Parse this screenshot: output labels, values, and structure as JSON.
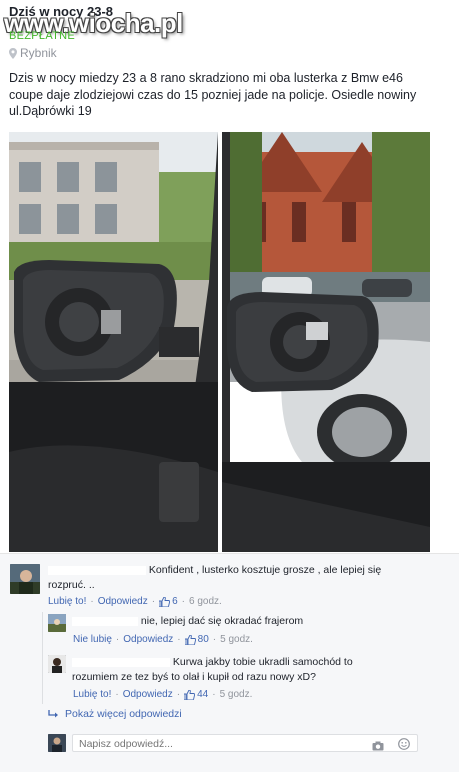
{
  "post": {
    "title": "Dziś w nocy 23-8",
    "watermark": "www.wiocha.pl",
    "price": "BEZPŁATNE",
    "location": "Rybnik",
    "body": "Dzis w nocy miedzy 23 a 8 rano skradziono mi oba lusterka z Bmw e46 coupe daje zlodziejowi czas do 15 pozniej jade na policje. Osiedle nowiny ul.Dąbrówki 19"
  },
  "comments": [
    {
      "text": "Konfident , lusterko kosztuje grosze , ale lepiej się rozpruć. ..",
      "like_label": "Lubię to!",
      "reply_label": "Odpowiedz",
      "likes": "6",
      "time": "6 godz."
    }
  ],
  "replies": [
    {
      "text": "nie, lepiej dać się okradać frajerom",
      "like_label": "Nie lubię",
      "reply_label": "Odpowiedz",
      "likes": "80",
      "time": "5 godz."
    },
    {
      "text": "Kurwa jakby tobie ukradli samochód to rozumiem ze tez byś to olał i kupił od razu nowy xD?",
      "like_label": "Lubię to!",
      "reply_label": "Odpowiedz",
      "likes": "44",
      "time": "5 godz."
    }
  ],
  "more_replies": "Pokaż więcej odpowiedzi",
  "reply_box": {
    "placeholder": "Napisz odpowiedź..."
  },
  "colors": {
    "link": "#4267b2",
    "muted": "#90949c",
    "green": "#42b72a",
    "text": "#1d2129"
  },
  "icons": [
    "pin-icon",
    "thumb-up-icon",
    "reply-arrow-icon",
    "camera-icon",
    "emoji-icon"
  ]
}
